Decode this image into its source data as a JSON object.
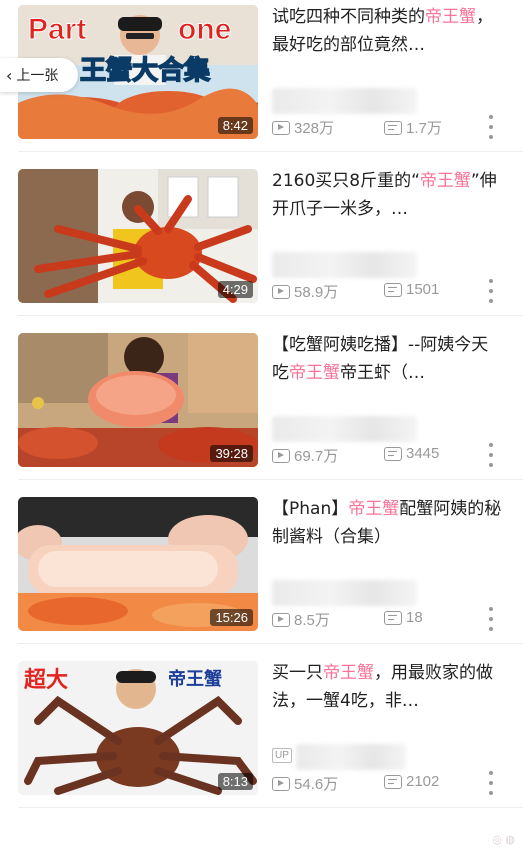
{
  "back_button": {
    "label": "上一张"
  },
  "videos": [
    {
      "title_pre": "试吃四种不同种类的",
      "title_hl": "帝王蟹",
      "title_post": "，最好吃的部位竟然…",
      "duration": "8:42",
      "views": "328万",
      "danmaku": "1.7万",
      "thumb_text_1": "Part",
      "thumb_text_2": "one",
      "thumb_text_3": "王蟹大合集"
    },
    {
      "title_pre": "2160买只8斤重的“",
      "title_hl": "帝王蟹",
      "title_post": "”伸开爪子一米多，…",
      "duration": "4:29",
      "views": "58.9万",
      "danmaku": "1501"
    },
    {
      "title_pre": "【吃蟹阿姨吃播】--阿姨今天吃",
      "title_hl": "帝王蟹",
      "title_post": "帝王虾（…",
      "duration": "39:28",
      "views": "69.7万",
      "danmaku": "3445"
    },
    {
      "title_pre": "【Phan】",
      "title_hl": "帝王蟹",
      "title_post": "配蟹阿姨的秘制酱料（合集）",
      "duration": "15:26",
      "views": "8.5万",
      "danmaku": "18"
    },
    {
      "title_pre": "买一只",
      "title_hl": "帝王蟹",
      "title_post": "，用最败家的做法，一蟹4吃，非…",
      "duration": "8:13",
      "views": "54.6万",
      "danmaku": "2102",
      "up_badge": "UP",
      "thumb_text_1": "超大",
      "thumb_text_2": "帝王蟹"
    }
  ],
  "colors": {
    "highlight": "#fb7299",
    "meta": "#999999",
    "title": "#212121"
  },
  "icons": {
    "views": "play-count-icon",
    "danmaku": "danmaku-count-icon",
    "more": "more-vertical-icon",
    "back": "chevron-left-icon"
  }
}
